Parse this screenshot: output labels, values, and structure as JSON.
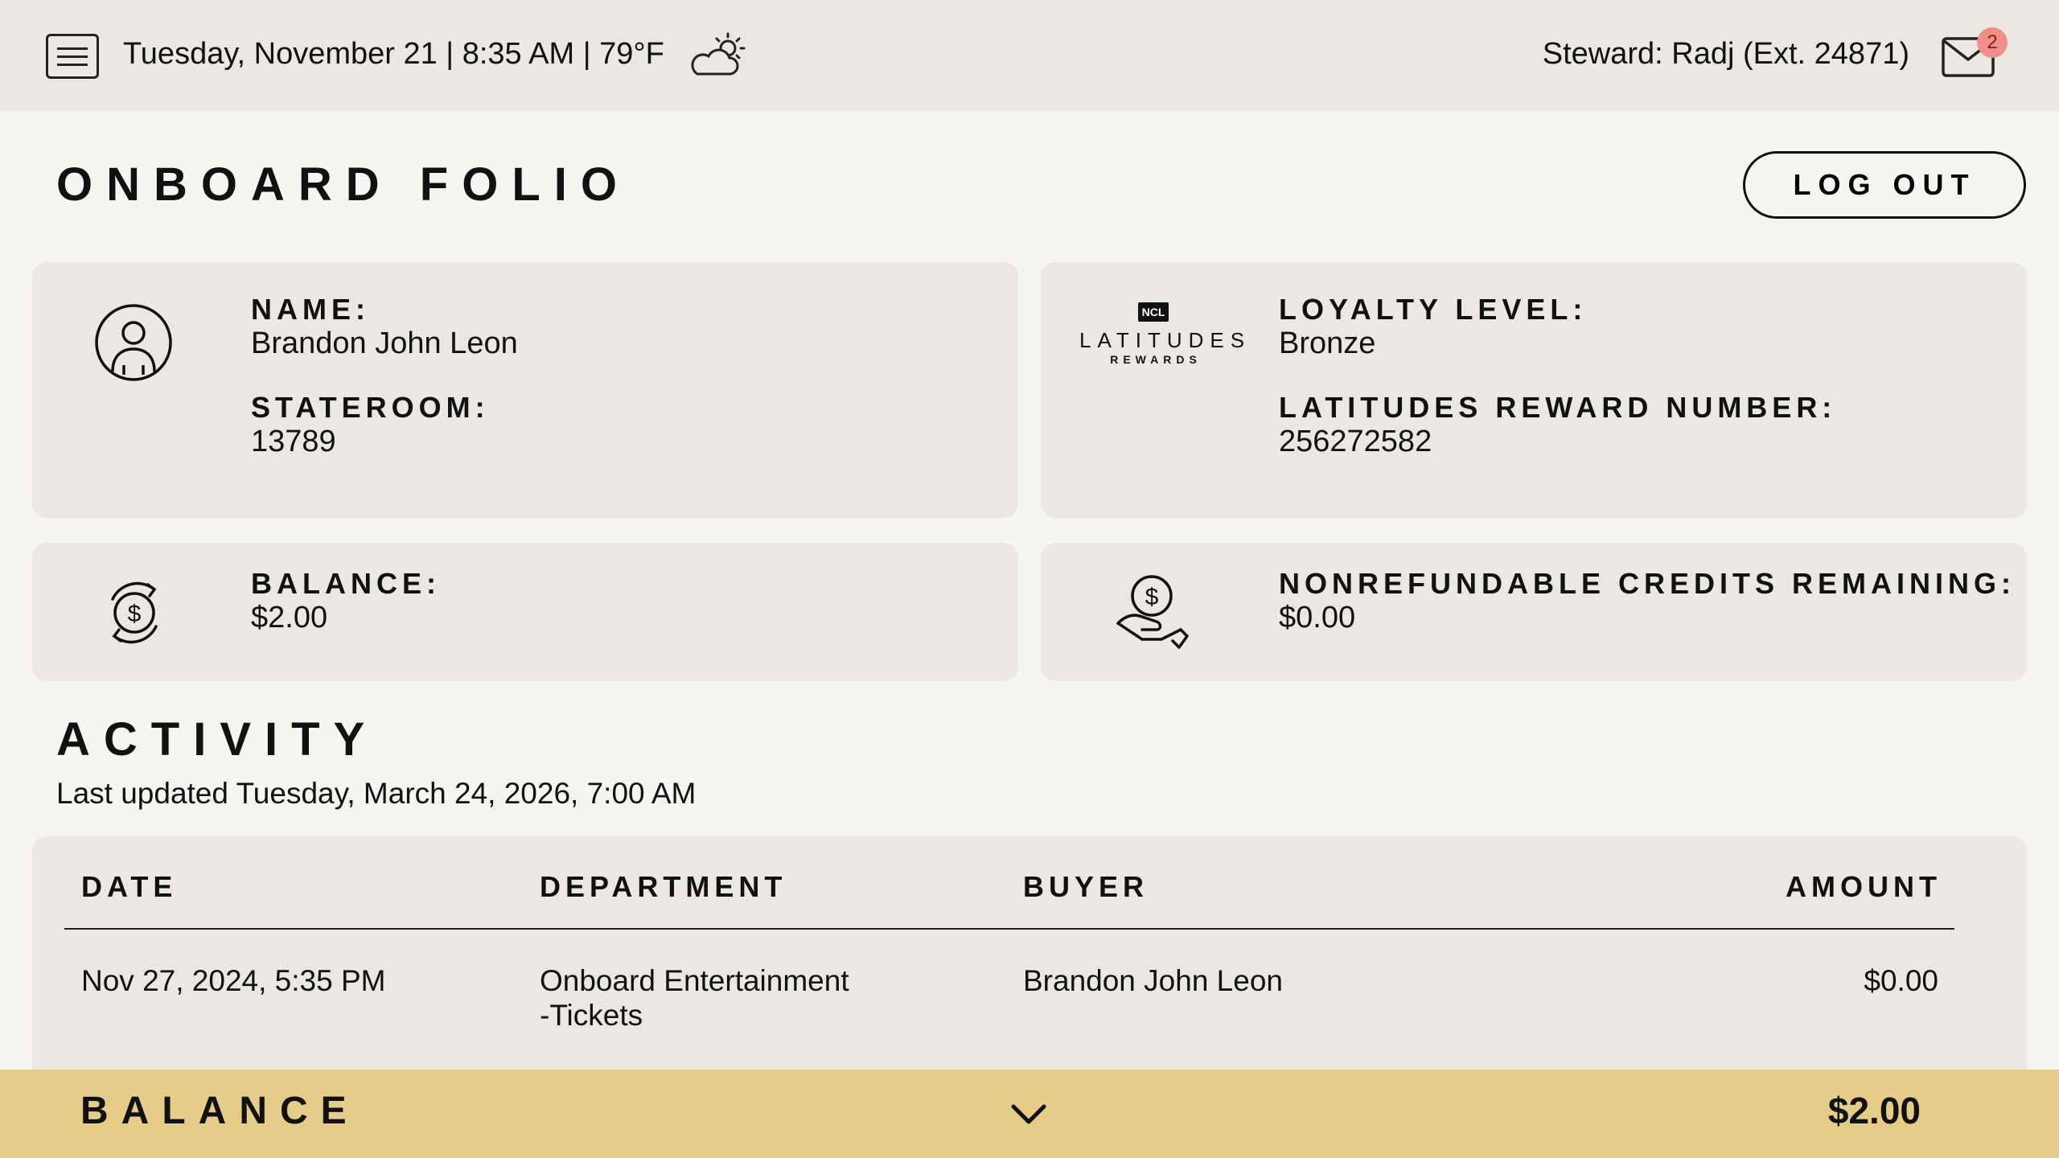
{
  "topbar": {
    "datetime": "Tuesday, November 21 | 8:35 AM | 79°F",
    "steward": "Steward: Radj (Ext. 24871)",
    "mail_count": "2"
  },
  "page": {
    "title": "ONBOARD FOLIO",
    "logout_label": "LOG OUT"
  },
  "guest": {
    "name_label": "NAME:",
    "name": "Brandon John Leon",
    "stateroom_label": "STATEROOM:",
    "stateroom": "13789"
  },
  "loyalty": {
    "logo_brand": "NCL",
    "logo_title": "LATITUDES",
    "logo_sub": "REWARDS",
    "level_label": "LOYALTY LEVEL:",
    "level": "Bronze",
    "number_label": "LATITUDES REWARD NUMBER:",
    "number": "256272582"
  },
  "balance_card": {
    "label": "BALANCE:",
    "value": "$2.00"
  },
  "credits_card": {
    "label": "NONREFUNDABLE CREDITS REMAINING:",
    "value": "$0.00"
  },
  "activity": {
    "title": "ACTIVITY",
    "updated": "Last updated Tuesday, March 24, 2026, 7:00 AM",
    "columns": [
      "DATE",
      "DEPARTMENT",
      "BUYER",
      "AMOUNT"
    ],
    "rows": [
      {
        "date": "Nov 27, 2024, 5:35 PM",
        "department_line1": "Onboard Entertainment",
        "department_line2": "-Tickets",
        "buyer": "Brandon John Leon",
        "amount": "$0.00"
      }
    ]
  },
  "footer": {
    "label": "BALANCE",
    "value": "$2.00"
  },
  "colors": {
    "topbar": "#ebe8e3",
    "background": "#f6f5f2",
    "card": "#ebe8e3",
    "balance_bar": "#e5cd89",
    "badge": "#f08f8a"
  },
  "icons": [
    "menu-icon",
    "weather-partly-cloudy-icon",
    "mail-icon",
    "user-avatar-icon",
    "latitudes-rewards-logo",
    "dollar-cycle-icon",
    "hand-coin-icon",
    "chevron-down-icon"
  ]
}
